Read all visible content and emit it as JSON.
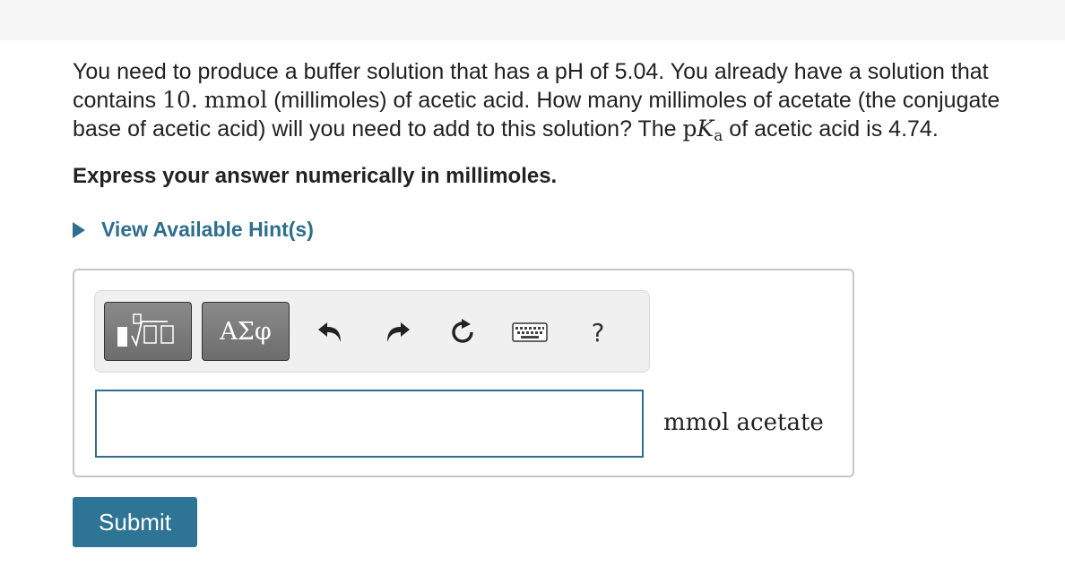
{
  "question": {
    "part1": "You need to produce a buffer solution that has a pH of 5.04. You already have a solution that contains ",
    "amount": "10.",
    "unit_math": "mmol",
    "part2": " (millimoles) of acetic acid. How many millimoles of acetate (the conjugate base of acetic acid) will you need to add to this solution? The ",
    "pka_p": "p",
    "pka_K": "K",
    "pka_sub": "a",
    "part3": " of acetic acid is 4.74."
  },
  "instruction": "Express your answer numerically in millimoles.",
  "hint_label": "View Available Hint(s)",
  "toolbar": {
    "templates_icon": "templates-icon",
    "symbols_label": "ΑΣφ",
    "undo_icon": "undo-icon",
    "redo_icon": "redo-icon",
    "reset_icon": "reset-icon",
    "keyboard_icon": "keyboard-icon",
    "help_label": "?"
  },
  "answer": {
    "value": "",
    "unit": "mmol acetate"
  },
  "submit_label": "Submit",
  "colors": {
    "accent": "#2e6e8e",
    "button": "#2e7595",
    "toolbar_button": "#7a7a7a"
  }
}
